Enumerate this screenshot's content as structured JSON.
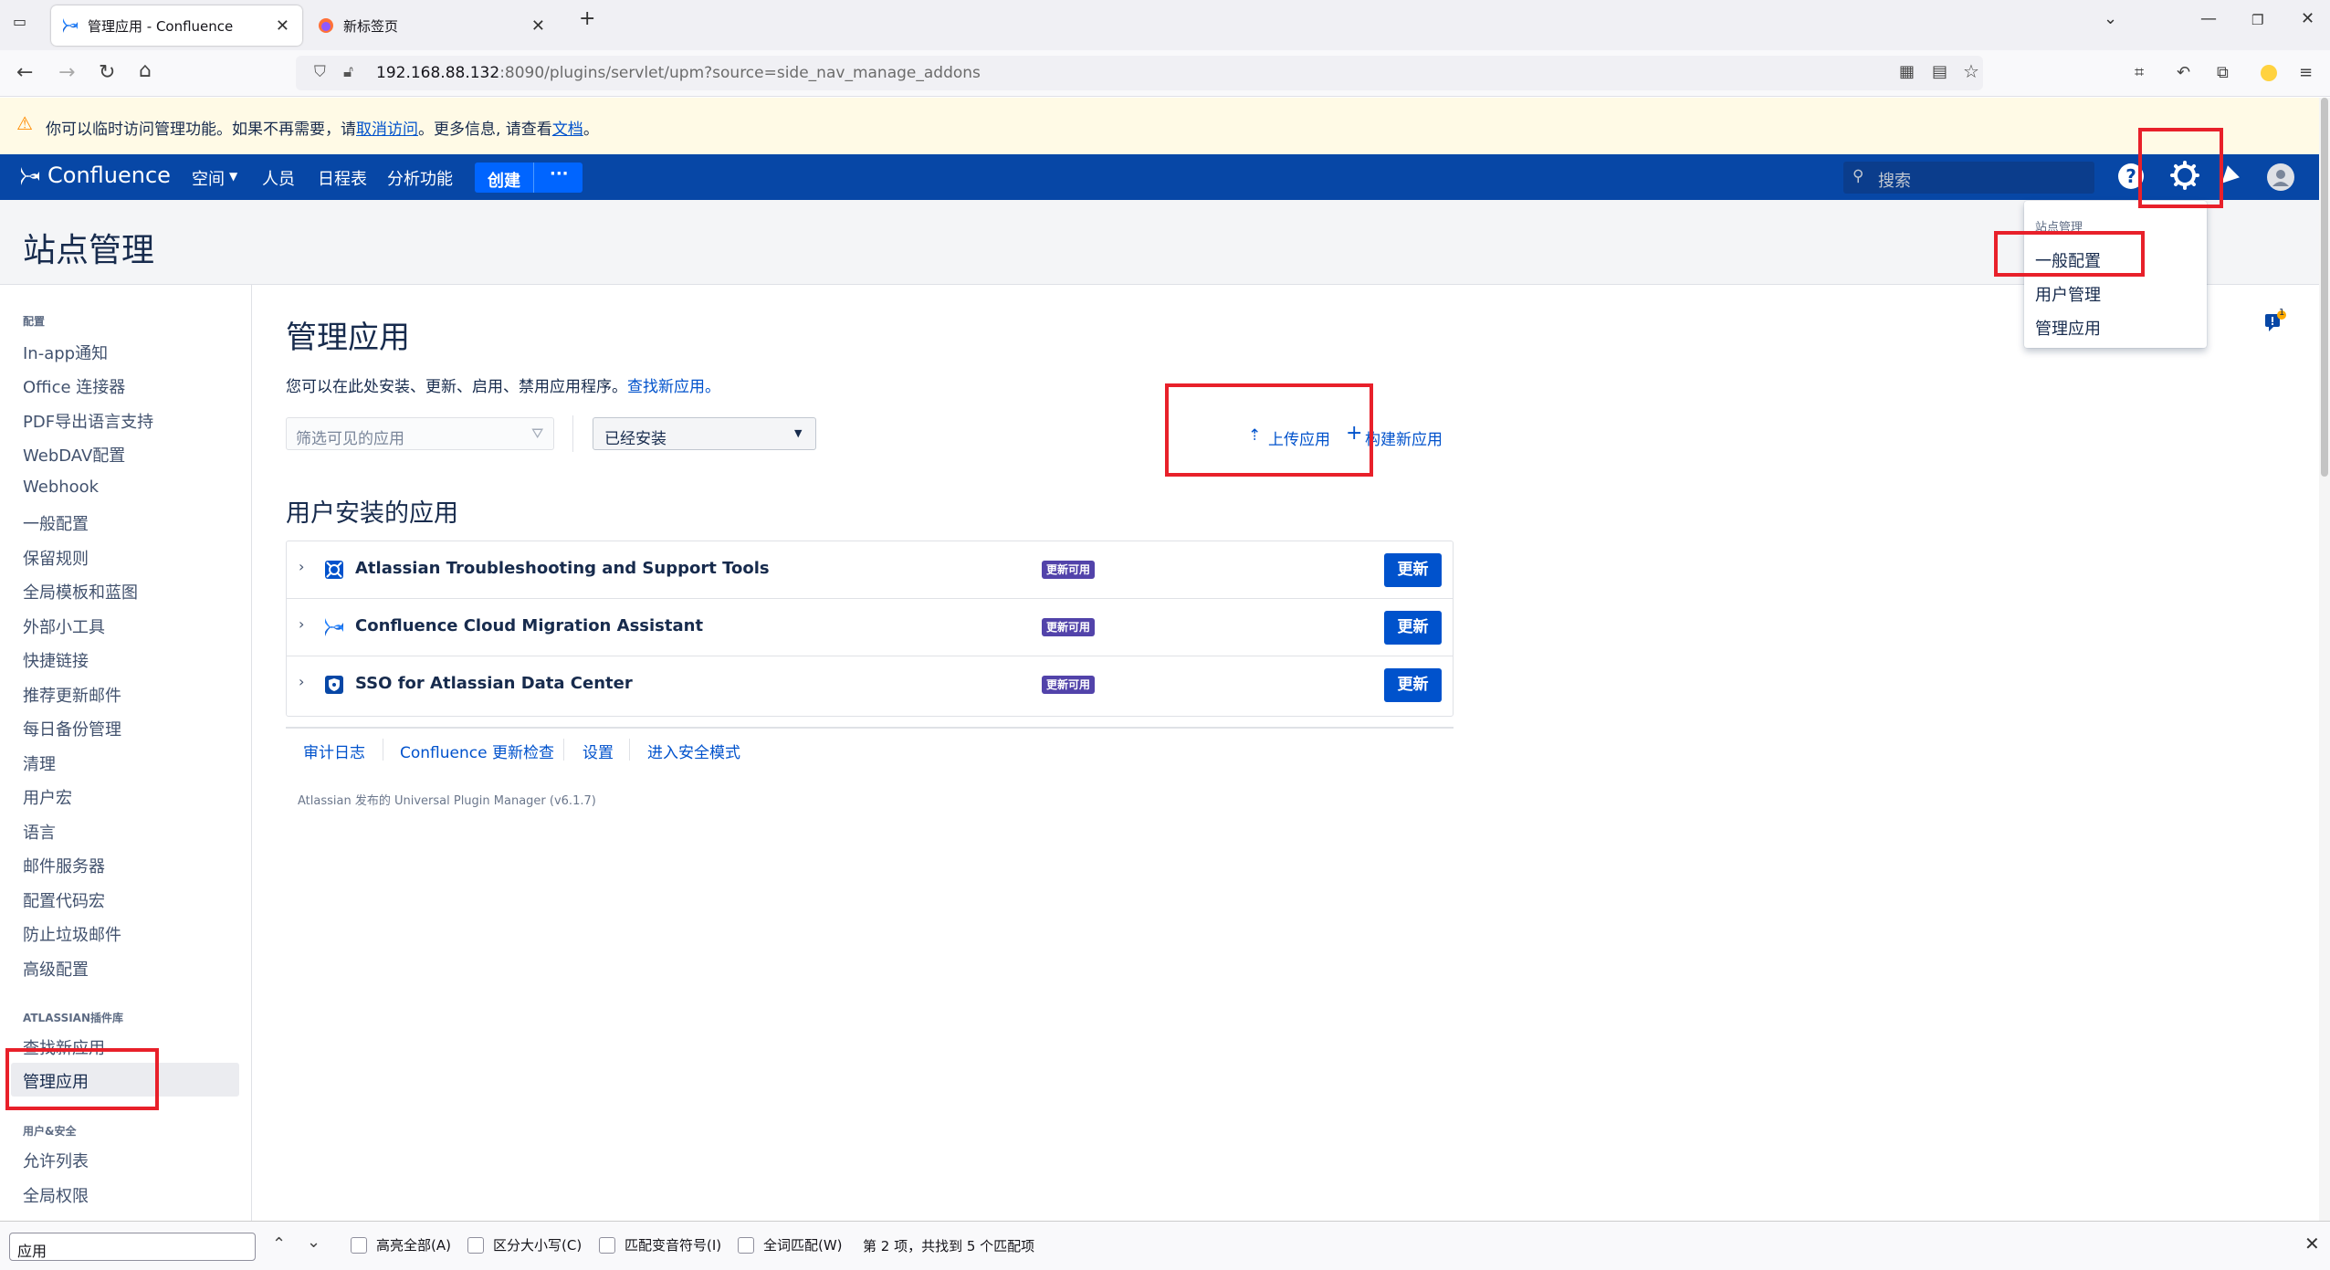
{
  "browser": {
    "tabs": [
      {
        "title": "管理应用 - Confluence",
        "active": true
      },
      {
        "title": "新标签页",
        "active": false
      }
    ],
    "url_host": "192.168.88.132",
    "url_rest": ":8090/plugins/servlet/upm?source=side_nav_manage_addons",
    "new_tab": "+"
  },
  "notice": {
    "text1": "你可以临时访问管理功能。如果不再需要，请",
    "link1": "取消访问",
    "text2": "。更多信息, 请查看",
    "link2": "文档",
    "text3": "。"
  },
  "header": {
    "logo": "Confluence",
    "nav": [
      "空间",
      "人员",
      "日程表",
      "分析功能"
    ],
    "create": "创建",
    "more": "···",
    "search_placeholder": "搜索",
    "help": "?"
  },
  "page_title": "站点管理",
  "sidebar": {
    "sections": [
      {
        "heading": "配置",
        "items": [
          "In-app通知",
          "Office 连接器",
          "PDF导出语言支持",
          "WebDAV配置",
          "Webhook",
          "一般配置",
          "保留规则",
          "全局模板和蓝图",
          "外部小工具",
          "快捷链接",
          "推荐更新邮件",
          "每日备份管理",
          "清理",
          "用户宏",
          "语言",
          "邮件服务器",
          "配置代码宏",
          "防止垃圾邮件",
          "高级配置"
        ]
      },
      {
        "heading": "ATLASSIAN插件库",
        "items": [
          "查找新应用",
          "管理应用"
        ]
      },
      {
        "heading": "用户&安全",
        "items": [
          "允许列表",
          "全局权限"
        ]
      }
    ],
    "active_item": "管理应用"
  },
  "main": {
    "title": "管理应用",
    "desc": "您可以在此处安装、更新、启用、禁用应用程序。",
    "desc_link": "查找新应用。",
    "filter_placeholder": "筛选可见的应用",
    "filter_select": "已经安装",
    "upload": "上传应用",
    "build": "构建新应用",
    "section_title": "用户安装的应用",
    "apps": [
      {
        "name": "Atlassian Troubleshooting and Support Tools",
        "badge": "更新可用",
        "button": "更新"
      },
      {
        "name": "Confluence Cloud Migration Assistant",
        "badge": "更新可用",
        "button": "更新"
      },
      {
        "name": "SSO for Atlassian Data Center",
        "badge": "更新可用",
        "button": "更新"
      }
    ],
    "footer_links": [
      "审计日志",
      "Confluence 更新检查",
      "设置",
      "进入安全模式"
    ],
    "upm_footer": "Atlassian 发布的 Universal Plugin Manager (v6.1.7)"
  },
  "admin_menu": {
    "heading": "站点管理",
    "items": [
      "一般配置",
      "用户管理",
      "管理应用"
    ]
  },
  "notification_count": "1",
  "findbar": {
    "query": "应用",
    "options": [
      "高亮全部(A)",
      "区分大小写(C)",
      "匹配变音符号(I)",
      "全词匹配(W)"
    ],
    "status": "第 2 项，共找到 5 个匹配项"
  },
  "colors": {
    "header": "#0747a6",
    "accent": "#0052cc",
    "badge": "#5243aa",
    "highlight": "#e8202a",
    "notice": "#fffae6"
  }
}
